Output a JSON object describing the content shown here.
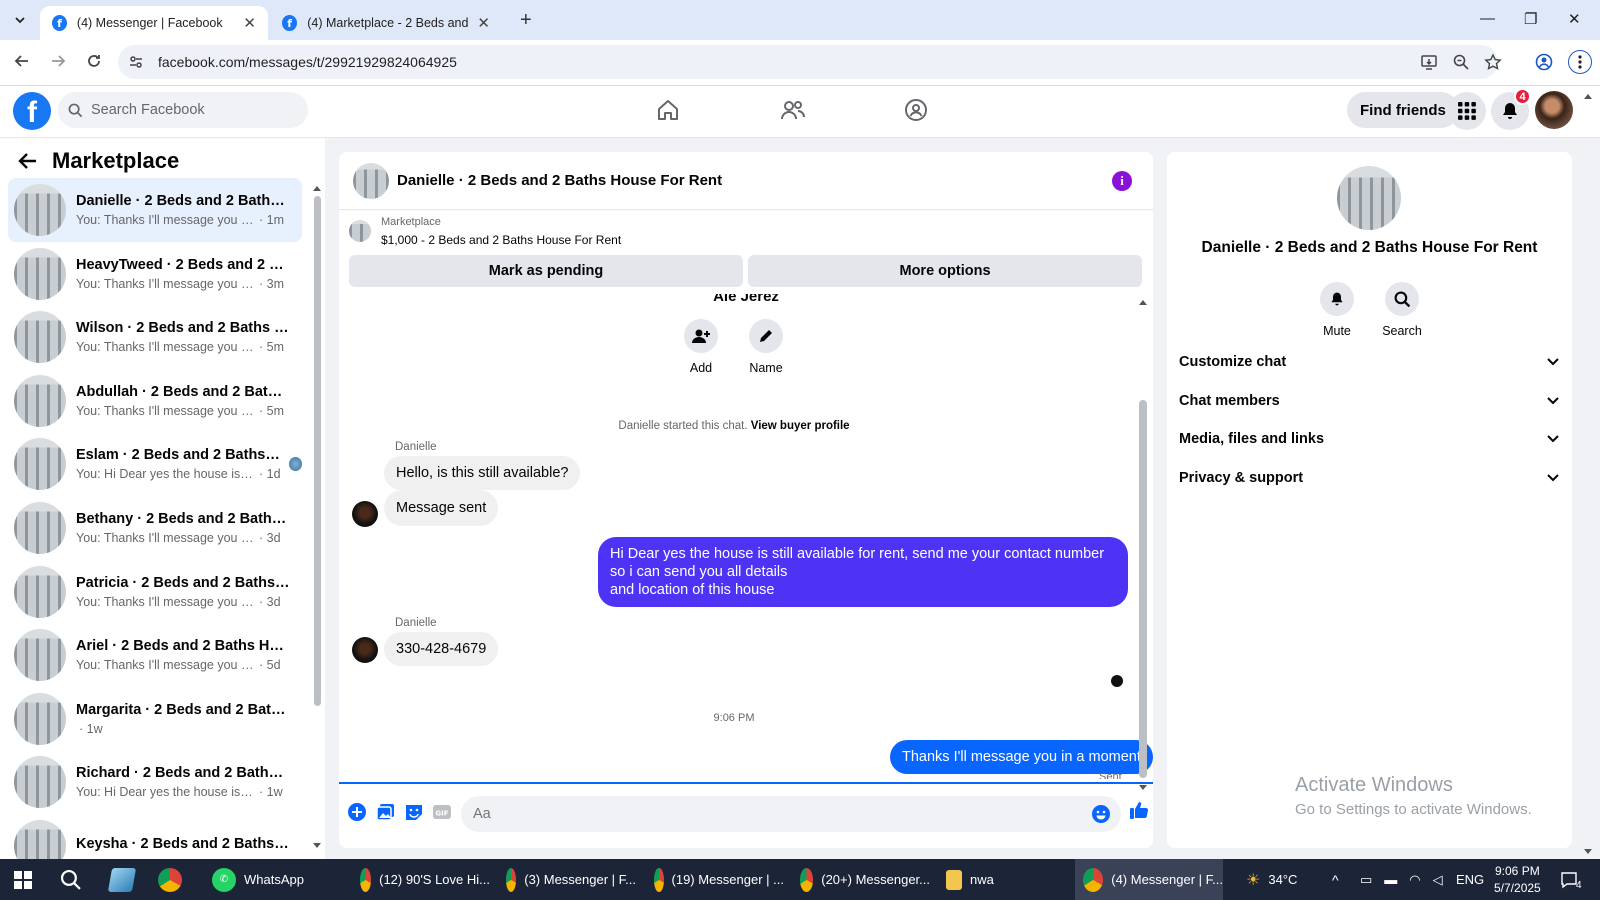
{
  "browser": {
    "tabs": [
      {
        "title": "(4) Messenger | Facebook",
        "active": true
      },
      {
        "title": "(4) Marketplace - 2 Beds and 2 Baths",
        "active": false
      }
    ],
    "url": "facebook.com/messages/t/29921929824064925"
  },
  "fb": {
    "search_placeholder": "Search Facebook",
    "find_friends": "Find friends",
    "notification_count": "4",
    "brand_color": "#1877f2"
  },
  "sidebar": {
    "title": "Marketplace",
    "conversations": [
      {
        "name": "Danielle · 2 Beds and 2 Baths H...",
        "preview": "You: Thanks I'll message you in a ...",
        "time": "· 1m",
        "selected": true
      },
      {
        "name": "HeavyTweed · 2 Beds and 2 Bat...",
        "preview": "You: Thanks I'll message you in a ...",
        "time": "· 3m"
      },
      {
        "name": "Wilson · 2 Beds and 2 Baths Ho...",
        "preview": "You: Thanks I'll message you in a ...",
        "time": "· 5m"
      },
      {
        "name": "Abdullah · 2 Beds and 2 Baths H...",
        "preview": "You: Thanks I'll message you in a ...",
        "time": "· 5m"
      },
      {
        "name": "Eslam · 2 Beds and 2 Baths H...",
        "preview": "You: Hi Dear yes the house is stil...",
        "time": "· 1d"
      },
      {
        "name": "Bethany · 2 Beds and 2 Baths H...",
        "preview": "You: Thanks I'll message you in a ...",
        "time": "· 3d"
      },
      {
        "name": "Patricia · 2 Beds and 2 Baths Ho...",
        "preview": "You: Thanks I'll message you in a ...",
        "time": "· 3d"
      },
      {
        "name": "Ariel · 2 Beds and 2 Baths Hous...",
        "preview": "You: Thanks I'll message you in a ...",
        "time": "· 5d"
      },
      {
        "name": "Margarita · 2 Beds and 2 Baths ...",
        "preview": "",
        "time": "· 1w"
      },
      {
        "name": "Richard · 2 Beds and 2 Baths Ho...",
        "preview": "You: Hi Dear yes the house is still a...",
        "time": "· 1w"
      },
      {
        "name": "Keysha · 2 Beds and 2 Baths Ho...",
        "preview": "",
        "time": ""
      }
    ]
  },
  "chat": {
    "title": "Danielle · 2 Beds and 2 Baths House For Rent",
    "listing_source": "Marketplace",
    "listing": "$1,000 - 2 Beds and 2 Baths House For Rent",
    "mark_pending": "Mark as pending",
    "more_options": "More options",
    "top_name": "Ale Jerez",
    "add_label": "Add",
    "name_label": "Name",
    "system_text": "Danielle started this chat.",
    "system_link": "View buyer profile",
    "messages": [
      {
        "sender": "Danielle",
        "text": "Hello, is this still available?"
      },
      {
        "text": "Message sent"
      },
      {
        "text": "Hi Dear yes the house is still available for rent, send me your contact number so i can send you all details\nand location of this house"
      },
      {
        "sender": "Danielle",
        "text": "330-428-4679"
      },
      {
        "text": "Thanks I'll message you in a moment"
      }
    ],
    "timestamp": "9:06 PM",
    "status": "Sent",
    "compose_placeholder": "Aa"
  },
  "details": {
    "name": "Danielle · 2 Beds and 2 Baths House For Rent",
    "mute": "Mute",
    "search": "Search",
    "sections": [
      "Customize chat",
      "Chat members",
      "Media, files and links",
      "Privacy & support"
    ],
    "watermark_title": "Activate Windows",
    "watermark_sub": "Go to Settings to activate Windows."
  },
  "taskbar": {
    "items": [
      "WhatsApp",
      "(12) 90'S Love Hi...",
      "(3) Messenger | F...",
      "(19) Messenger | ...",
      "(20+) Messenger...",
      "nwa",
      "(4) Messenger | F..."
    ],
    "temp": "34°C",
    "lang": "ENG",
    "time": "9:06 PM",
    "date": "5/7/2025",
    "notif": "4"
  }
}
